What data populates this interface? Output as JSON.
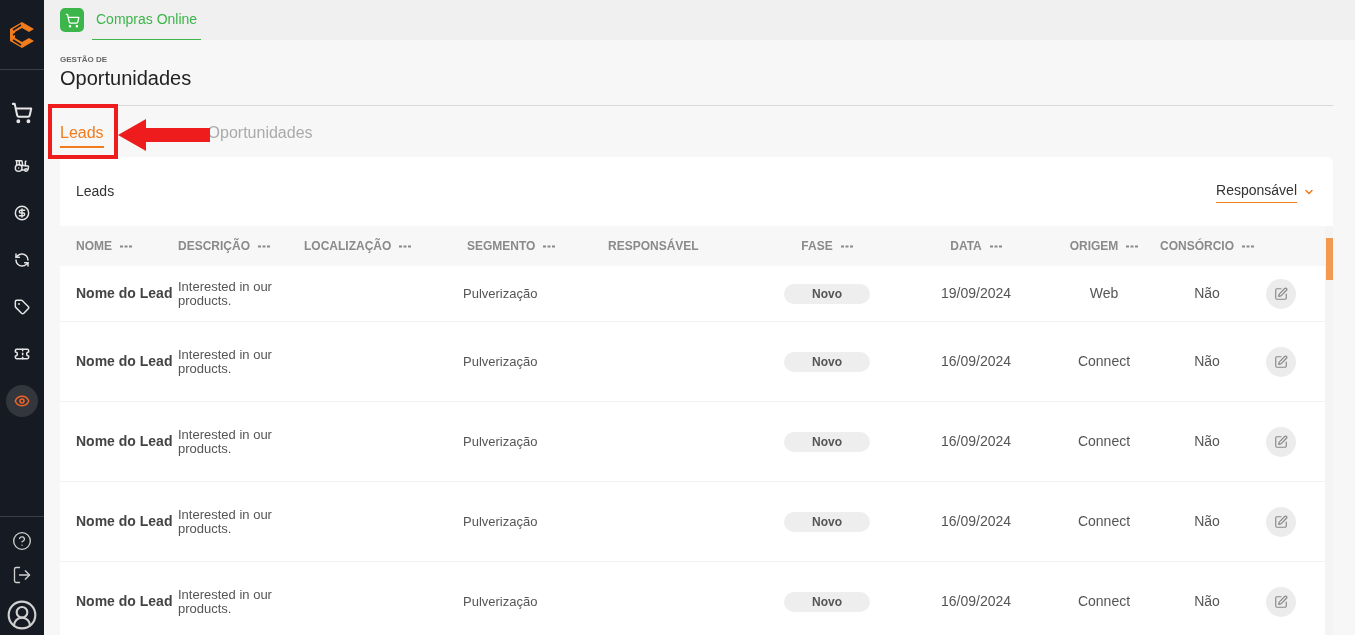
{
  "sidebar": {
    "items": [
      {
        "selected": false
      },
      {
        "selected": false
      },
      {
        "selected": false
      },
      {
        "selected": false
      },
      {
        "selected": false
      },
      {
        "selected": false
      },
      {
        "selected": true
      }
    ]
  },
  "top_tab": {
    "label": "Compras Online",
    "selected": true
  },
  "header": {
    "eyebrow": "GESTÃO DE",
    "title": "Oportunidades"
  },
  "tabs": [
    {
      "label": "Leads",
      "selected": true
    },
    {
      "label": "Oportunidades",
      "selected": false
    }
  ],
  "card": {
    "title": "Leads",
    "filter": "Responsável"
  },
  "table": {
    "columns": [
      {
        "label": "NOME",
        "sortable": true
      },
      {
        "label": "DESCRIÇÃO",
        "sortable": true
      },
      {
        "label": "LOCALIZAÇÃO",
        "sortable": true
      },
      {
        "label": "SEGMENTO",
        "sortable": true
      },
      {
        "label": "RESPONSÁVEL",
        "sortable": false
      },
      {
        "label": "FASE",
        "sortable": true
      },
      {
        "label": "DATA",
        "sortable": true
      },
      {
        "label": "ORIGEM",
        "sortable": true
      },
      {
        "label": "CONSÓRCIO",
        "sortable": true
      }
    ],
    "rows": [
      {
        "name": "Nome do Lead",
        "description": "Interested in our products.",
        "segment": "Pulverização",
        "phase": "Novo",
        "date": "19/09/2024",
        "origin": "Web",
        "consortium": "Não"
      },
      {
        "name": "Nome do Lead",
        "description": "Interested in our products.",
        "segment": "Pulverização",
        "phase": "Novo",
        "date": "16/09/2024",
        "origin": "Connect",
        "consortium": "Não"
      },
      {
        "name": "Nome do Lead",
        "description": "Interested in our products.",
        "segment": "Pulverização",
        "phase": "Novo",
        "date": "16/09/2024",
        "origin": "Connect",
        "consortium": "Não"
      },
      {
        "name": "Nome do Lead",
        "description": "Interested in our products.",
        "segment": "Pulverização",
        "phase": "Novo",
        "date": "16/09/2024",
        "origin": "Connect",
        "consortium": "Não"
      },
      {
        "name": "Nome do Lead",
        "description": "Interested in our products.",
        "segment": "Pulverização",
        "phase": "Novo",
        "date": "16/09/2024",
        "origin": "Connect",
        "consortium": "Não"
      }
    ]
  }
}
